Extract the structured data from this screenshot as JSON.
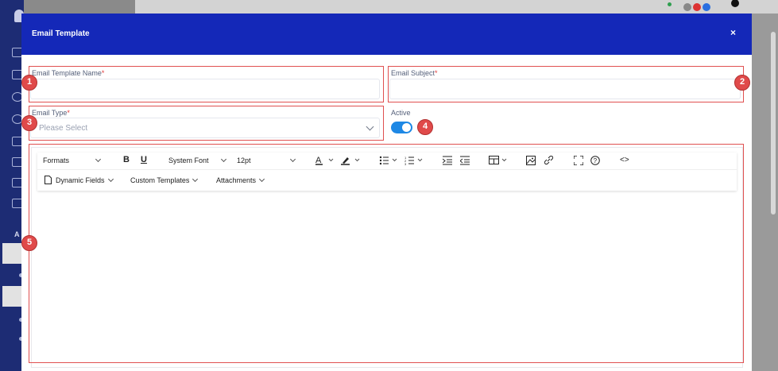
{
  "modal": {
    "title": "Email Template",
    "close_glyph": "×"
  },
  "sidebar": {
    "section_label": "A"
  },
  "fields": {
    "template_name": {
      "label": "Email Template Name",
      "required_mark": "*",
      "value": ""
    },
    "subject": {
      "label": "Email Subject",
      "required_mark": "*",
      "value": ""
    },
    "type": {
      "label": "Email Type",
      "required_mark": "*",
      "placeholder": "Please Select"
    },
    "active": {
      "label": "Active",
      "value": true
    }
  },
  "toolbar": {
    "formats": "Formats",
    "bold": "B",
    "underline": "U",
    "font": "System Font",
    "size": "12pt",
    "code": "<>",
    "dynamic_fields": "Dynamic Fields",
    "custom_templates": "Custom Templates",
    "attachments": "Attachments"
  },
  "badges": [
    "1",
    "2",
    "3",
    "4",
    "5"
  ],
  "colors": {
    "header": "#1428b8",
    "sidebar": "#1d2c74",
    "toggle": "#1e88e5",
    "highlight": "#e05050",
    "required": "#e23a3a"
  }
}
